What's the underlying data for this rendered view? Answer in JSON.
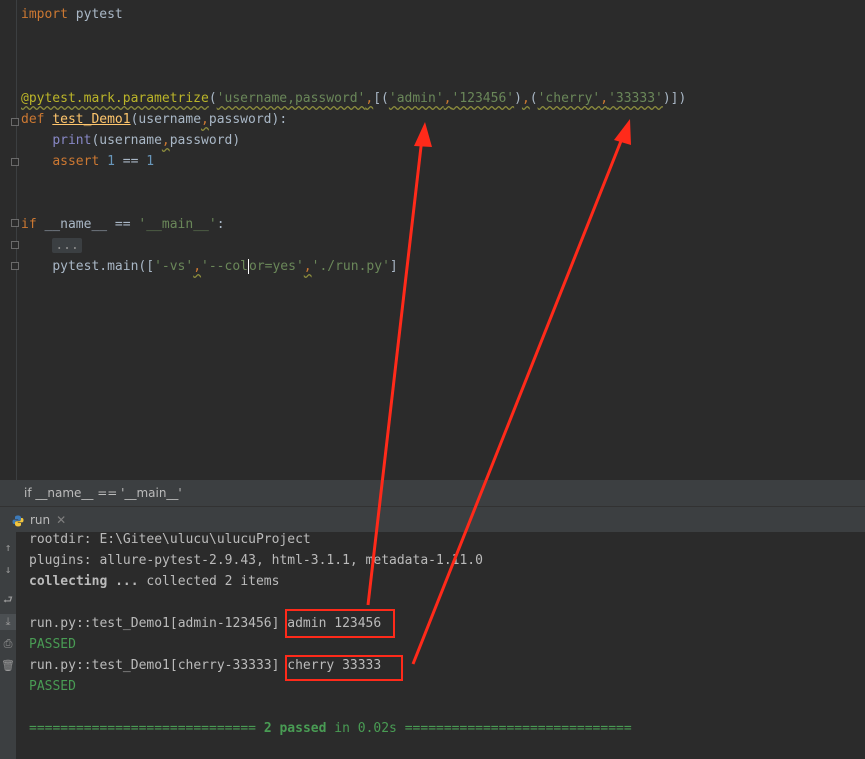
{
  "editor": {
    "code": {
      "l1": {
        "kw": "import",
        "mod": " pytest"
      },
      "l5": {
        "deco": "@pytest.mark.parametrize",
        "p1": "(",
        "s1": "'username,password'",
        "c1": ",",
        "p2": "[(",
        "s2": "'admin'",
        "c2": ",",
        "s3": "'123456'",
        "p3": ")",
        "c3": ",",
        "p4": "(",
        "s4": "'cherry'",
        "c4": ",",
        "s5": "'33333'",
        "p5": ")])"
      },
      "l6": {
        "kw": "def",
        "fn": "test_Demo1",
        "p1": "(username",
        "c1": ",",
        "p2": "password):"
      },
      "l7": {
        "bi": "print",
        "p1": "(username",
        "c1": ",",
        "p2": "password)"
      },
      "l8": {
        "kw": "assert",
        "n1": "1",
        "op": " == ",
        "n2": "1"
      },
      "l11": {
        "kw": "if",
        "p1": " __name__ == ",
        "s1": "'__main__'",
        "p2": ":"
      },
      "l12": {
        "ellipsis": "..."
      },
      "l13": {
        "p1": "pytest.main([",
        "s1": "'-vs'",
        "c1": ",",
        "s2a": "'--col",
        "s2b": "or=yes'",
        "c2": ",",
        "s3": "'./run.py'",
        "p2": "]"
      }
    }
  },
  "breadcrumb": {
    "text": "if __name__ == '__main__'"
  },
  "run_panel": {
    "tab_label": "run",
    "lines": {
      "rootdir": "rootdir: E:\\Gitee\\ulucu\\ulucuProject",
      "plugins": "plugins: allure-pytest-2.9.43, html-3.1.1, metadata-1.11.0",
      "collecting_bold": "collecting ...",
      "collecting_rest": " collected 2 items",
      "test1": "run.py::test_Demo1[admin-123456]",
      "test1_out": "admin 123456",
      "passed1": "PASSED",
      "test2": "run.py::test_Demo1[cherry-33333]",
      "test2_out": "cherry 33333",
      "passed2": "PASSED",
      "summary_left": "============================= ",
      "summary_bold": "2 passed",
      "summary_mid": " in 0.02s",
      "summary_right": " ============================="
    }
  },
  "colors": {
    "annotation": "#ff2a1a",
    "passed": "#499c54"
  }
}
